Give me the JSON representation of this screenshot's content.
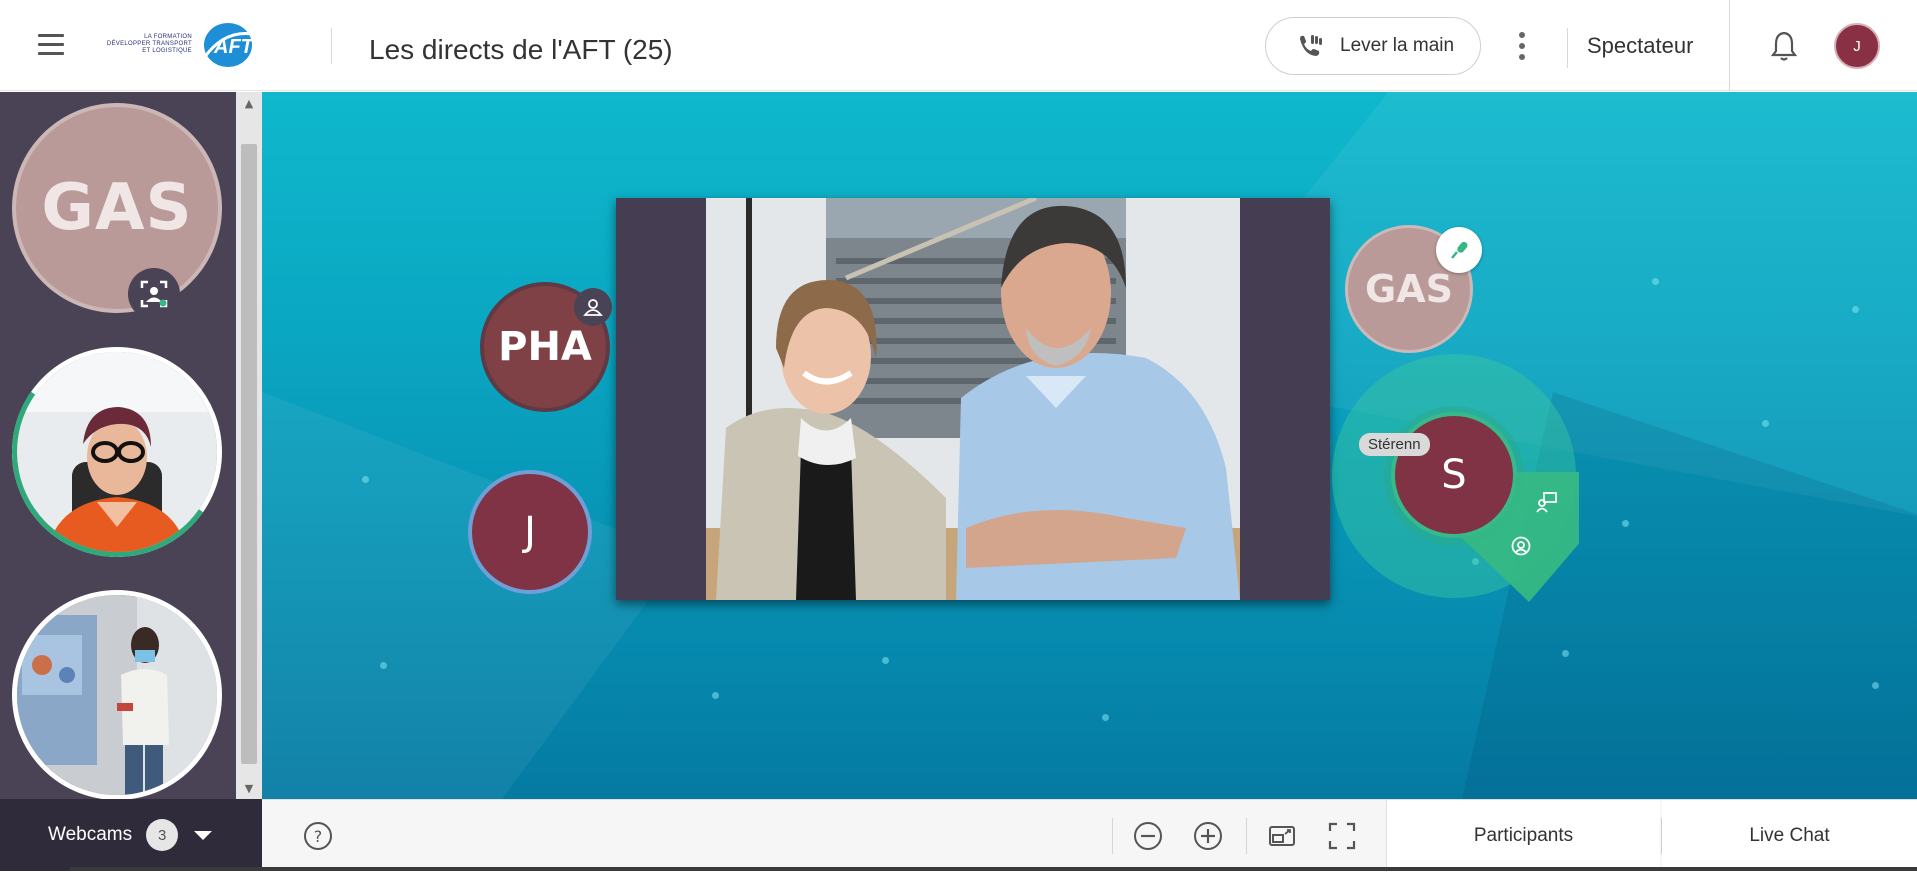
{
  "header": {
    "menu_icon": "hamburger-menu-icon",
    "logo_tagline": "LA FORMATION DÉVELOPPER TRANSPORT ET LOGISTIQUE",
    "logo_text": "AFT",
    "title": "Les directs de l'AFT (25)",
    "raise_hand_label": "Lever la main",
    "raise_hand_icon": "raise-hand-icon",
    "more_icon": "kebab-menu-icon",
    "role_label": "Spectateur",
    "bell_icon": "bell-icon",
    "user_initial": "J"
  },
  "sidebar": {
    "webcams": [
      {
        "type": "initials",
        "text": "GAS",
        "badge_icon": "camera-user-icon"
      },
      {
        "type": "video",
        "description_icon": "webcam-feed"
      },
      {
        "type": "video",
        "description_icon": "webcam-feed"
      }
    ]
  },
  "stage": {
    "participants": [
      {
        "initials": "PHA",
        "badge_icon": "moderator-icon"
      },
      {
        "initials": "J"
      },
      {
        "initials": "GAS",
        "badge_icon": "microphone-icon"
      },
      {
        "initials": "S",
        "name_tag": "Stérenn",
        "menu_icons": [
          "presentation-icon",
          "at-sign-icon"
        ]
      }
    ]
  },
  "bottom": {
    "webcams_label": "Webcams",
    "webcams_count": "3",
    "help_icon": "help-icon",
    "zoom_out_icon": "zoom-out-icon",
    "zoom_in_icon": "zoom-in-icon",
    "picture_in_picture_icon": "pip-icon",
    "fullscreen_icon": "fullscreen-icon",
    "tabs": [
      "Participants",
      "Live Chat"
    ]
  },
  "colors": {
    "stage_top": "#0fb8cc",
    "stage_bottom": "#057aa2",
    "panel": "#4a4255",
    "avatar_red": "#7f3345",
    "speaking_green": "#35b884"
  }
}
